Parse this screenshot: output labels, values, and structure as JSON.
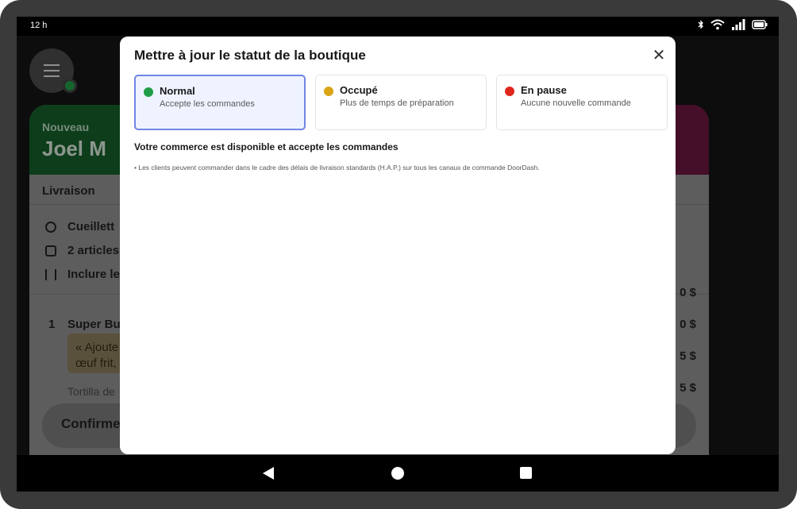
{
  "status_bar": {
    "time": "12 h",
    "icons": [
      "bluetooth-icon",
      "wifi-icon",
      "cellular-signal-icon",
      "battery-icon"
    ]
  },
  "background": {
    "order_card": {
      "badge": "Nouveau",
      "customer_name": "Joel M",
      "fulfillment": "Livraison",
      "info_lines": [
        "Cueillett",
        "2 articles",
        "Inclure le"
      ],
      "item_qty": "1",
      "item_name": "Super Bu",
      "item_note_line1": "« Ajoute",
      "item_note_line2": "œuf frit,",
      "item_option": "Tortilla de",
      "prices": [
        "0 $",
        "0 $",
        "5 $",
        "5 $"
      ],
      "confirm_label": "Confirme"
    }
  },
  "modal": {
    "title": "Mettre à jour le statut de la boutique",
    "options": [
      {
        "label": "Normal",
        "sublabel": "Accepte les commandes",
        "color": "#1f9d46",
        "selected": true
      },
      {
        "label": "Occupé",
        "sublabel": "Plus de temps de préparation",
        "color": "#d9a514",
        "selected": false
      },
      {
        "label": "En pause",
        "sublabel": "Aucune nouvelle commande",
        "color": "#e1261c",
        "selected": false
      }
    ],
    "description_title": "Votre commerce est disponible et accepte les commandes",
    "description_bullet": "• Les clients peuvent commander dans le cadre des délais de livraison standards (H.A.P.) sur tous les canaux de commande DoorDash."
  },
  "nav_bar": {
    "icons": [
      "back-icon",
      "home-icon",
      "recents-icon"
    ]
  },
  "colors": {
    "accent_selected_border": "#6f86e4",
    "accent_selected_bg": "#eef3ff"
  }
}
